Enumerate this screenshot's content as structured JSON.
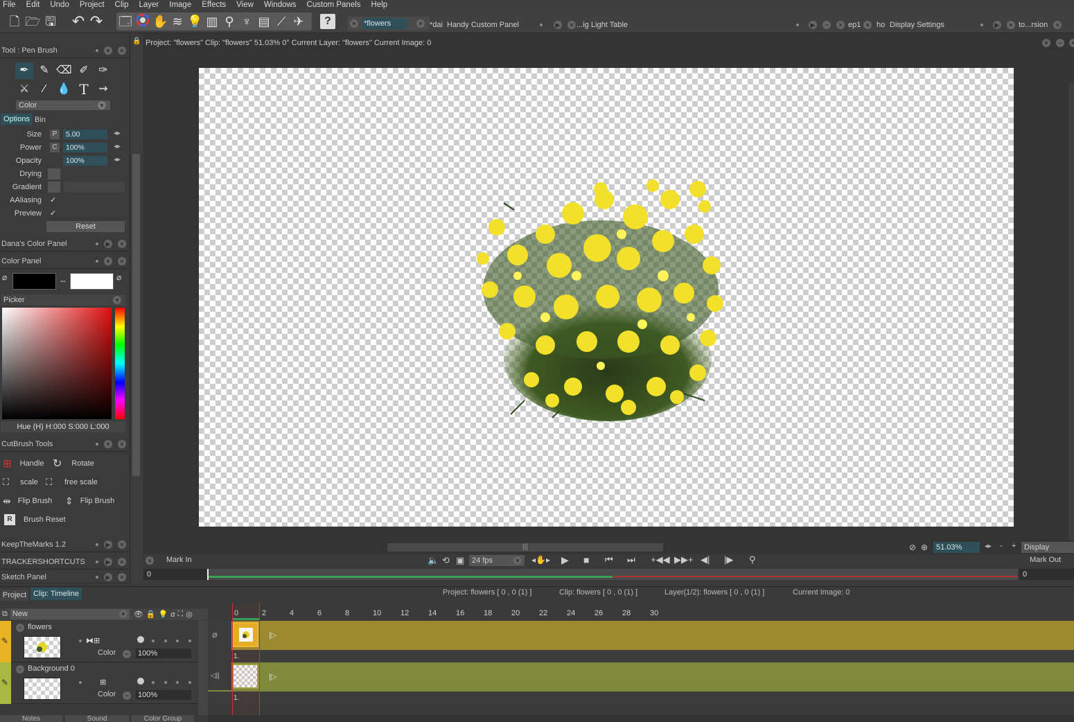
{
  "menu": [
    "File",
    "Edit",
    "Undo",
    "Project",
    "Clip",
    "Layer",
    "Image",
    "Effects",
    "View",
    "Windows",
    "Custom Panels",
    "Help"
  ],
  "tabs": {
    "flowers": "*flowers",
    "dai": "*dai",
    "handy": "Handy Custom Panel",
    "ig": "...ig",
    "light_table": "Light Table",
    "ep1": "ep1",
    "ho": "ho",
    "display_settings": "Display Settings",
    "rsion": "to...rsion"
  },
  "tool_panel": {
    "title": "Tool : Pen Brush",
    "color_dropdown": "Color",
    "tab_options": "Options",
    "tab_bin": "Bin",
    "size_label": "Size",
    "size_mod": "P",
    "size_value": "5.00",
    "power_label": "Power",
    "power_mod": "C",
    "power_value": "100%",
    "opacity_label": "Opacity",
    "opacity_value": "100%",
    "drying_label": "Drying",
    "gradient_label": "Gradient",
    "aaliasing_label": "AAliasing",
    "preview_label": "Preview",
    "reset_label": "Reset"
  },
  "panels": {
    "danas": "Dana's Color Panel",
    "color": "Color Panel",
    "picker": "Picker",
    "hsl": "Hue (H) H:000 S:000 L:000",
    "cutbrush": "CutBrush Tools",
    "keepmarks": "KeepTheMarks 1.2",
    "tracker": "TRACKERSHORTCUTS",
    "sketch": "Sketch Panel"
  },
  "cutbrush": {
    "handle": "Handle",
    "rotate": "Rotate",
    "scale": "scale",
    "free_scale": "free scale",
    "flip_h": "Flip Brush",
    "flip_v": "Flip Brush",
    "reset": "Brush Reset"
  },
  "project_info": "Project:  \"flowers\"  Clip: \"flowers\"   51.03%   0°  Current Layer: \"flowers\"  Current Image: 0",
  "transport": {
    "mark_in": "Mark In",
    "mark_out": "Mark Out",
    "fps": "24 fps",
    "zoom": "51.03%",
    "display": "Display",
    "in_value": "0",
    "out_value": "0",
    "minus": "-",
    "plus": "+"
  },
  "bottom": {
    "tab_project": "Project",
    "tab_timeline": "Clip: Timeline",
    "info_project": "Project: flowers [ 0 , 0  (1) ]",
    "info_clip": "Clip: flowers [ 0 , 0  (1) ]",
    "info_layer": "Layer(1/2): flowers [ 0 , 0  (1) ]",
    "info_image": "Current Image: 0",
    "new_label": "New",
    "ticks": [
      "0",
      "2",
      "4",
      "6",
      "8",
      "10",
      "12",
      "14",
      "16",
      "18",
      "20",
      "22",
      "24",
      "26",
      "28",
      "30"
    ],
    "bottom_tabs": [
      "Notes",
      "Sound",
      "Color Group"
    ]
  },
  "layers": [
    {
      "name": "flowers",
      "blend": "Color",
      "opacity": "100%",
      "frame": "1."
    },
    {
      "name": "Background 0",
      "blend": "Color",
      "opacity": "100%",
      "frame": "1."
    }
  ],
  "colors": {
    "accent": "#2f4f5a",
    "flowers_track": "#9c8a30",
    "background_track": "#7f8a3c",
    "flowers_tag": "#e6b422",
    "background_tag": "#a8b840",
    "playhead": "#c83232"
  }
}
